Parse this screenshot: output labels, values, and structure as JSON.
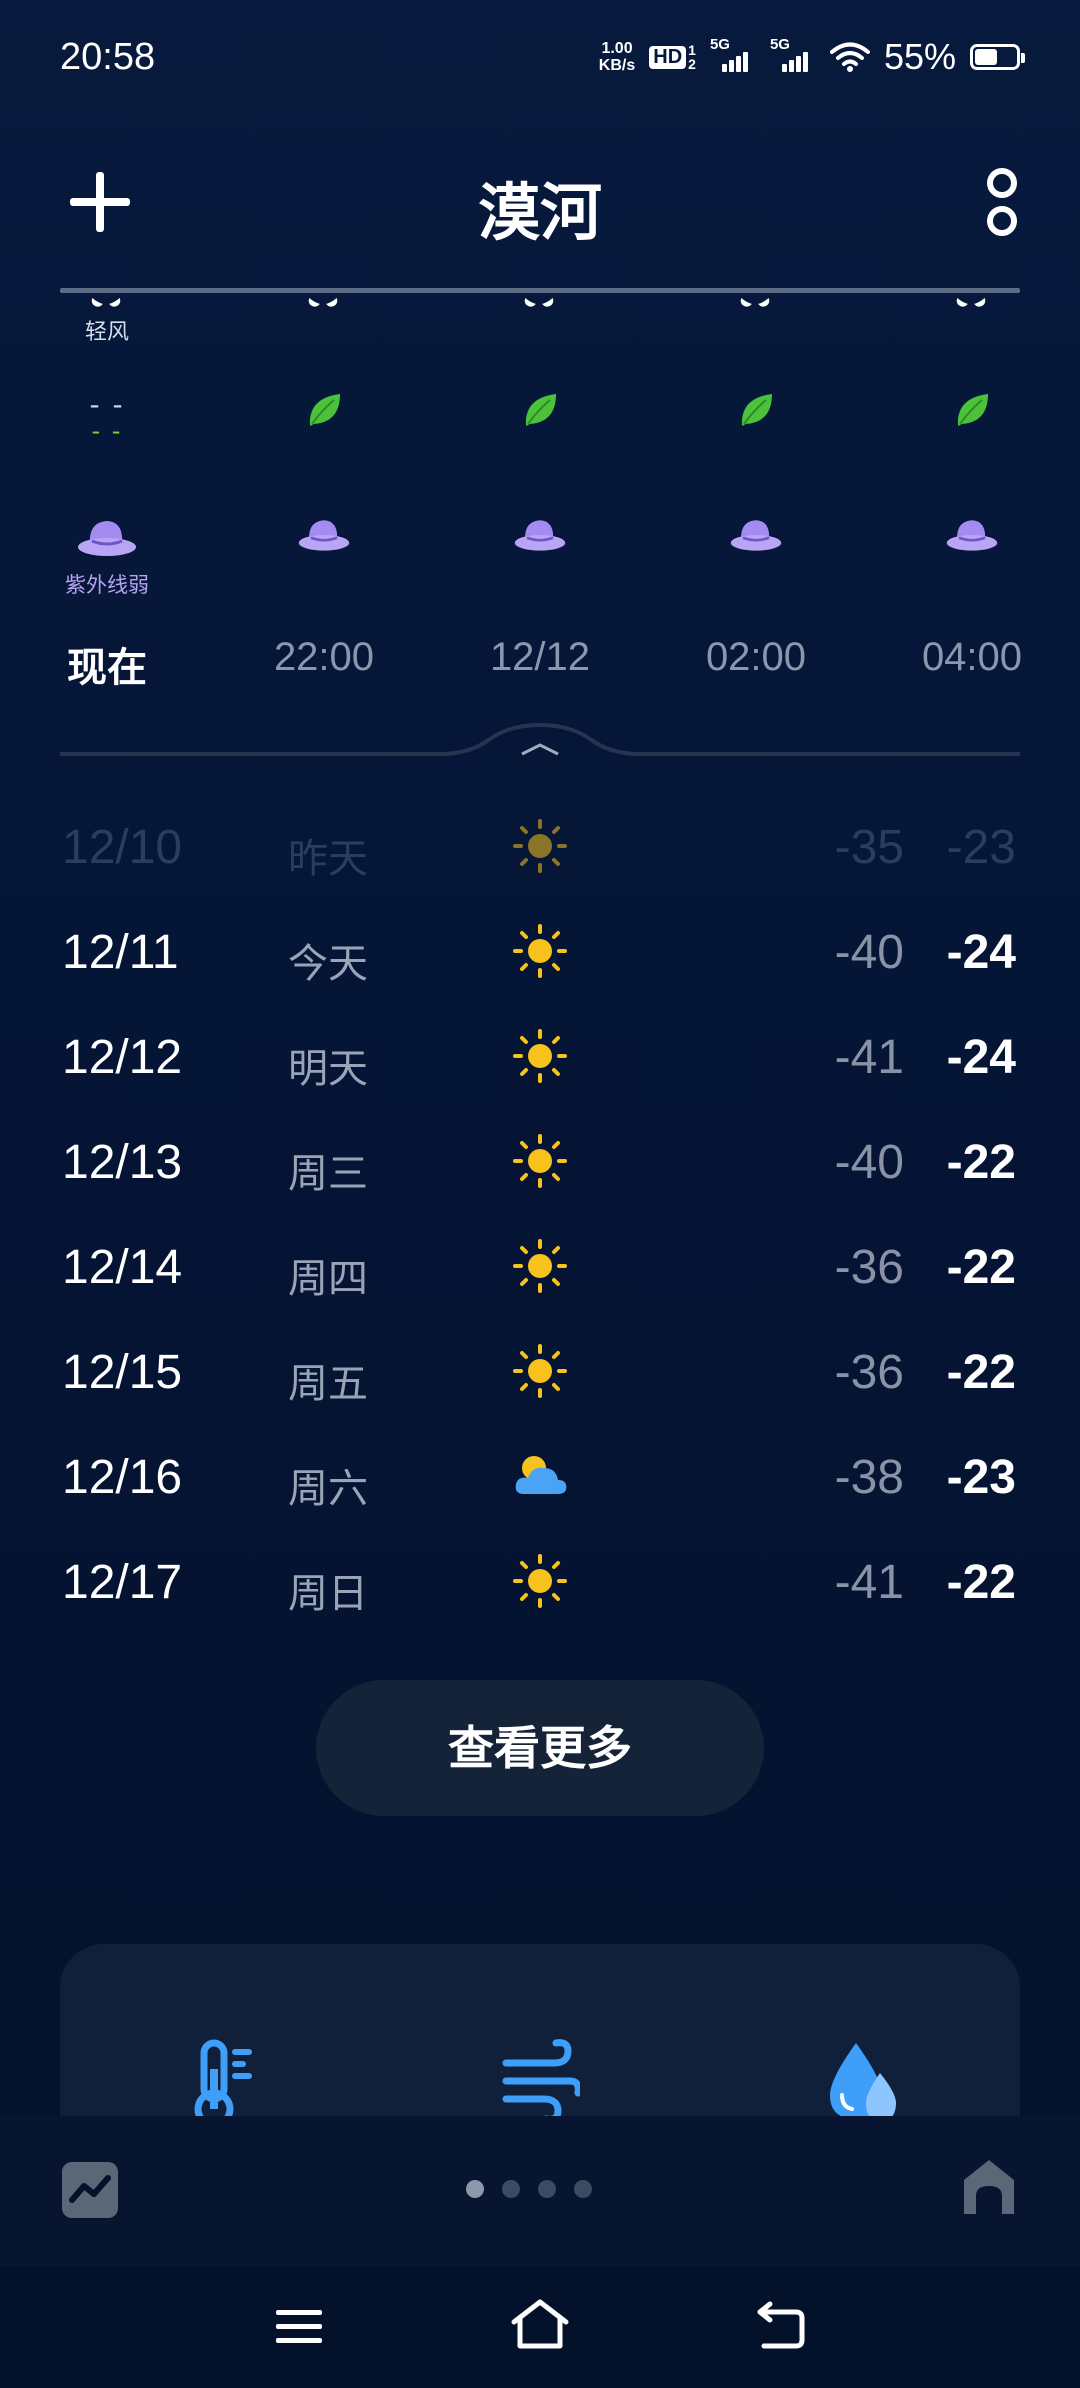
{
  "status_bar": {
    "time": "20:58",
    "net_speed_value": "1.00",
    "net_speed_unit": "KB/s",
    "hd_label": "HD",
    "sim1": "1",
    "sim2": "2",
    "signal1_label": "5G",
    "signal2_label": "5G",
    "battery_percent": "55%",
    "battery_level": 0.55
  },
  "header": {
    "city": "漠河"
  },
  "hourly": {
    "wind_label_now": "轻风",
    "aqi_now_top": "- -",
    "aqi_now_bottom": "- -",
    "uv_label_now": "紫外线弱",
    "columns": [
      {
        "time": "现在"
      },
      {
        "time": "22:00"
      },
      {
        "time": "12/12"
      },
      {
        "time": "02:00"
      },
      {
        "time": "04:00"
      }
    ]
  },
  "daily": [
    {
      "date": "12/10",
      "day": "昨天",
      "icon": "sun-icon",
      "low": "-35",
      "high": "-23",
      "past": true
    },
    {
      "date": "12/11",
      "day": "今天",
      "icon": "sun-icon",
      "low": "-40",
      "high": "-24"
    },
    {
      "date": "12/12",
      "day": "明天",
      "icon": "sun-icon",
      "low": "-41",
      "high": "-24"
    },
    {
      "date": "12/13",
      "day": "周三",
      "icon": "sun-icon",
      "low": "-40",
      "high": "-22"
    },
    {
      "date": "12/14",
      "day": "周四",
      "icon": "sun-icon",
      "low": "-36",
      "high": "-22"
    },
    {
      "date": "12/15",
      "day": "周五",
      "icon": "sun-icon",
      "low": "-36",
      "high": "-22"
    },
    {
      "date": "12/16",
      "day": "周六",
      "icon": "partly-cloudy-icon",
      "low": "-38",
      "high": "-23"
    },
    {
      "date": "12/17",
      "day": "周日",
      "icon": "sun-icon",
      "low": "-41",
      "high": "-22"
    }
  ],
  "more_button_label": "查看更多",
  "pager": {
    "pages": 4,
    "active": 0
  },
  "colors": {
    "background": "#04122c",
    "sun": "#f7c21c",
    "cloud": "#4aa3f5",
    "leaf": "#4cc23a",
    "uv_hat": "#a38bf0",
    "detail_icon": "#3f9ef7"
  }
}
